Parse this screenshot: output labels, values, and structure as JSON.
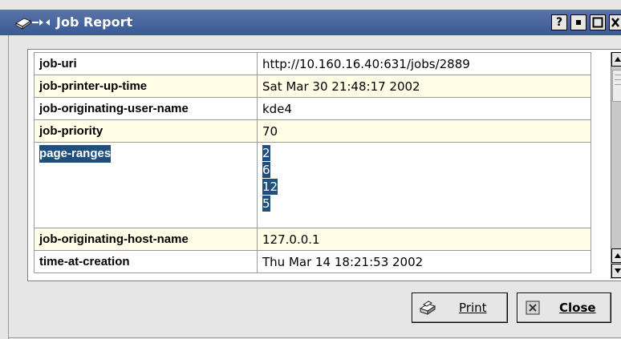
{
  "window": {
    "title": "Job Report",
    "buttons": {
      "help": "?",
      "minimize": "▪",
      "maximize": "□",
      "close": "x"
    }
  },
  "rows": [
    {
      "key": "job-uri",
      "value": "http://10.160.16.40:631/jobs/2889"
    },
    {
      "key": "job-printer-up-time",
      "value": "Sat Mar 30 21:48:17 2002"
    },
    {
      "key": "job-originating-user-name",
      "value": "kde4"
    },
    {
      "key": "job-priority",
      "value": "70"
    },
    {
      "key": "page-ranges",
      "values": [
        "2",
        "6",
        "12",
        "5"
      ]
    },
    {
      "key": "job-originating-host-name",
      "value": "127.0.0.1"
    },
    {
      "key": "time-at-creation",
      "value": "Thu Mar 14 18:21:53 2002"
    }
  ],
  "actions": {
    "print": "Print",
    "close": "Close"
  },
  "colors": {
    "titlebar": "#3a5a95",
    "selection": "#1e4f7d",
    "row_alt": "#fffde6"
  }
}
